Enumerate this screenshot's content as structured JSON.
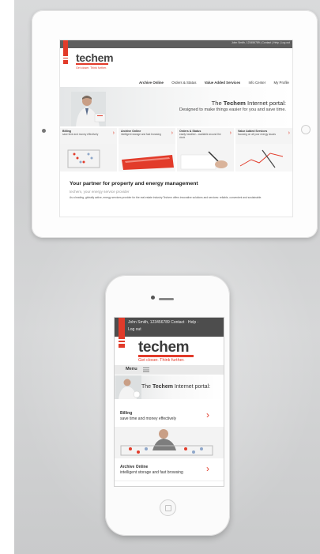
{
  "colors": {
    "brand_red": "#e23b2a",
    "dark_bar": "#5e5e5e",
    "text": "#333333"
  },
  "ipad": {
    "topbar_links": "John Smith, 123456789 | Contact | Help | Log out",
    "logo": "techem",
    "tagline": "Get closer. Think further.",
    "nav": [
      "Archive Online",
      "Orders & Status",
      "Value Added Services",
      "Info Center",
      "My Profile"
    ],
    "hero": {
      "title_prefix": "The ",
      "title_brand": "Techem",
      "title_suffix": " Internet portal:",
      "subtitle": "Designed to make things easier for you and save time."
    },
    "cards": [
      {
        "title": "Billing",
        "text": "save time and money effectively"
      },
      {
        "title": "Archive Online",
        "text": "intelligent storage and fast browsing"
      },
      {
        "title": "Orders & Status",
        "text": "easily handled – available around the clock"
      },
      {
        "title": "Value Added Services",
        "text": "focusing on all your energy issues"
      }
    ],
    "partner_heading": "Your partner for property and energy management",
    "partner_sub": "techem, your energy service provider",
    "partner_text": "As a leading, globally active, energy services provider for the real estate industry Techem offers innovative solutions and services: reliable, convenient and sustainable."
  },
  "iphone": {
    "user": "John Smith, 123456789   Contact  ·  Help  ·",
    "logout": "Log out",
    "logo": "techem",
    "tagline": "Get closer. Think further.",
    "menu": "Menu",
    "hero": {
      "title_prefix": "The ",
      "title_brand": "Techem",
      "title_suffix": " Internet portal:"
    },
    "items": [
      {
        "title": "Billing",
        "subtitle": "save time and money effectively"
      },
      {
        "title": "Archive Online",
        "subtitle": "intelligent storage and fast browsing"
      }
    ]
  }
}
